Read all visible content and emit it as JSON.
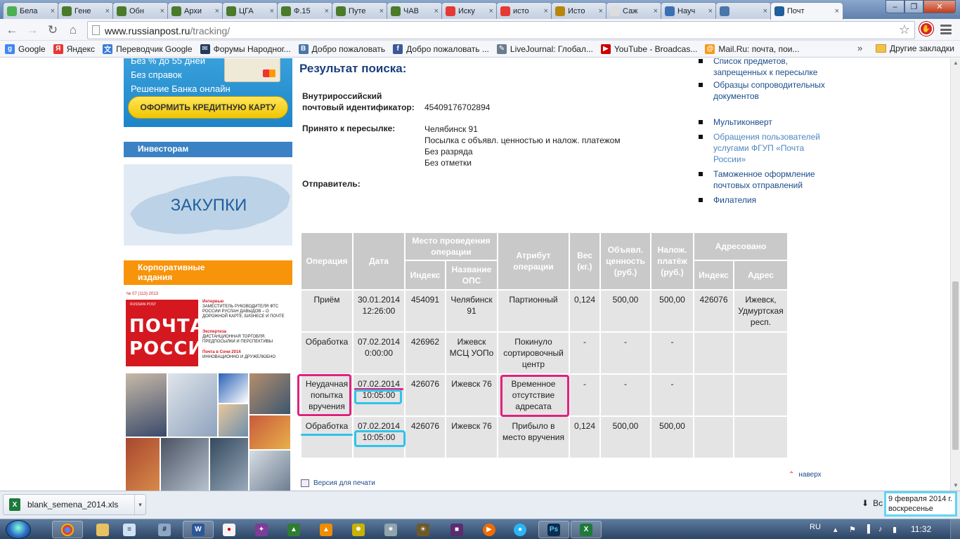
{
  "browser": {
    "tabs": [
      {
        "title": "Бела",
        "color": "#4caf50"
      },
      {
        "title": "Гене",
        "color": "#4a7a2a"
      },
      {
        "title": "Обн",
        "color": "#4a7a2a"
      },
      {
        "title": "Архи",
        "color": "#4a7a2a"
      },
      {
        "title": "ЦГА",
        "color": "#4a7a2a"
      },
      {
        "title": "Ф.15",
        "color": "#4a7a2a"
      },
      {
        "title": "Путе",
        "color": "#4a7a2a"
      },
      {
        "title": "ЧАВ",
        "color": "#4a7a2a"
      },
      {
        "title": "Иску",
        "color": "#e53935"
      },
      {
        "title": "исто",
        "color": "#e53935"
      },
      {
        "title": "Исто",
        "color": "#b8860b"
      },
      {
        "title": "Саж",
        "color": "#dddddd"
      },
      {
        "title": "Науч",
        "color": "#3b6fb6"
      },
      {
        "title": "",
        "color": "#4a76a8"
      },
      {
        "title": "Почт",
        "color": "#1f5f9c",
        "active": true
      }
    ],
    "address": {
      "domain": "www.russianpost.ru",
      "path": "/tracking/"
    },
    "bookmarks": [
      {
        "label": "Google",
        "icon": "google-icon",
        "color": "#4285f4",
        "glyph": "g"
      },
      {
        "label": "Яндекс",
        "icon": "yandex-icon",
        "color": "#e53935",
        "glyph": "Я"
      },
      {
        "label": "Переводчик Google",
        "icon": "translate-icon",
        "color": "#3b7bd6",
        "glyph": "文"
      },
      {
        "label": "Форумы Народног...",
        "icon": "mail-icon",
        "color": "#23395d",
        "glyph": "✉"
      },
      {
        "label": "Добро пожаловать",
        "icon": "vk-icon",
        "color": "#4a76a8",
        "glyph": "B"
      },
      {
        "label": "Добро пожаловать ...",
        "icon": "facebook-icon",
        "color": "#3b5998",
        "glyph": "f"
      },
      {
        "label": "LiveJournal: Глобал...",
        "icon": "pencil-icon",
        "color": "#6b7b8c",
        "glyph": "✎"
      },
      {
        "label": "YouTube - Broadcas...",
        "icon": "youtube-icon",
        "color": "#cc0000",
        "glyph": "▶"
      },
      {
        "label": "Mail.Ru: почта, пои...",
        "icon": "mailru-icon",
        "color": "#f59a1b",
        "glyph": "@"
      }
    ],
    "more_label": "»",
    "other_bookmarks": "Другие закладки"
  },
  "sidebar": {
    "ad_lines": [
      "Без % до 55 дней",
      "Без справок",
      "Решение Банка онлайн"
    ],
    "ad_button": "ОФОРМИТЬ КРЕДИТНУЮ КАРТУ",
    "investors": "Инвесторам",
    "zakupki": "ЗАКУПКИ",
    "corporate": [
      "Корпоративные",
      "издания"
    ],
    "magazine": {
      "issue": "№ 07 (113) 2013",
      "brand": "RUSSIAN POST",
      "title_1": "ПОЧТА",
      "title_2": "РОССИИ",
      "blocks": [
        {
          "head": "Интервью",
          "text": "ЗАМЕСТИТЕЛЬ РУКОВОДИТЕЛЯ ФТС РОССИИ РУСЛАН ДАВЫДОВ – О ДОРОЖНОЙ КАРТЕ, БИЗНЕСЕ И ПОЧТЕ"
        },
        {
          "head": "Экспертиза",
          "text": "ДИСТАНЦИОННАЯ ТОРГОВЛЯ. ПРЕДПОСЫЛКИ И ПЕРСПЕКТИВЫ"
        },
        {
          "head": "Почта в Сочи 2014",
          "text": "ИННОВАЦИОННО И ДРУЖЕЛЮБНО"
        }
      ]
    }
  },
  "result": {
    "title": "Результат поиска:",
    "id_label_1": "Внутрироссийский",
    "id_label_2": "почтовый идентификатор:",
    "id_value": "45409176702894",
    "accepted_label": "Принято к пересылке:",
    "accepted_values": [
      "Челябинск 91",
      "Посылка с объявл. ценностью и налож. платежом",
      "Без разряда",
      "Без отметки"
    ],
    "sender_label": "Отправитель:"
  },
  "right_links": [
    {
      "text": "Список предметов, запрещенных к пересылке"
    },
    {
      "text": "Образцы сопроводительных документов"
    },
    {
      "text": "Мультиконверт"
    },
    {
      "text": "Обращения пользователей услугами ФГУП «Почта России»",
      "light": true
    },
    {
      "text": "Таможенное оформление почтовых отправлений"
    },
    {
      "text": "Филателия"
    }
  ],
  "table": {
    "headers": {
      "operation": "Операция",
      "date": "Дата",
      "place": "Место проведения операции",
      "place_index": "Индекс",
      "place_name": "Название ОПС",
      "attribute": "Атрибут операции",
      "weight": "Вес (кг.)",
      "declared": "Объявл. ценность (руб.)",
      "cod": "Налож. платёж (руб.)",
      "addressed": "Адресовано",
      "addr_index": "Индекс",
      "addr_address": "Адрес"
    },
    "rows": [
      {
        "operation": "Приём",
        "date": "30.01.2014 12:26:00",
        "index": "454091",
        "office": "Челябинск 91",
        "attribute": "Партионный",
        "weight": "0,124",
        "declared": "500,00",
        "cod": "500,00",
        "addr_index": "426076",
        "address": "Ижевск, Удмуртская респ."
      },
      {
        "operation": "Обработка",
        "date": "07.02.2014 0:00:00",
        "index": "426962",
        "office": "Ижевск МСЦ УОПо",
        "attribute": "Покинуло сортировочный центр",
        "weight": "-",
        "declared": "-",
        "cod": "-",
        "addr_index": "",
        "address": ""
      },
      {
        "operation": "Неудачная попытка вручения",
        "date": "07.02.2014 10:05:00",
        "index": "426076",
        "office": "Ижевск 76",
        "attribute": "Временное отсутствие адресата",
        "weight": "-",
        "declared": "-",
        "cod": "-",
        "addr_index": "",
        "address": ""
      },
      {
        "operation": "Обработка",
        "date": "07.02.2014 10:05:00",
        "index": "426076",
        "office": "Ижевск 76",
        "attribute": "Прибыло в место вручения",
        "weight": "0,124",
        "declared": "500,00",
        "cod": "500,00",
        "addr_index": "",
        "address": ""
      }
    ]
  },
  "links": {
    "print": "Версия для печати",
    "top": "наверх"
  },
  "download": {
    "file": "blank_semena_2014.xls",
    "show_all": "Вс"
  },
  "tooltip": {
    "date": "9 февраля 2014 г.",
    "weekday": "воскресенье"
  },
  "taskbar": {
    "lang": "RU",
    "time": "11:32"
  },
  "colors": {
    "highlight_pink": "#e0227e",
    "highlight_cyan": "#2ec4ea",
    "title_blue": "#1a3f7e",
    "investors_bar": "#3b82c4",
    "corporate_bar": "#f7940a"
  }
}
